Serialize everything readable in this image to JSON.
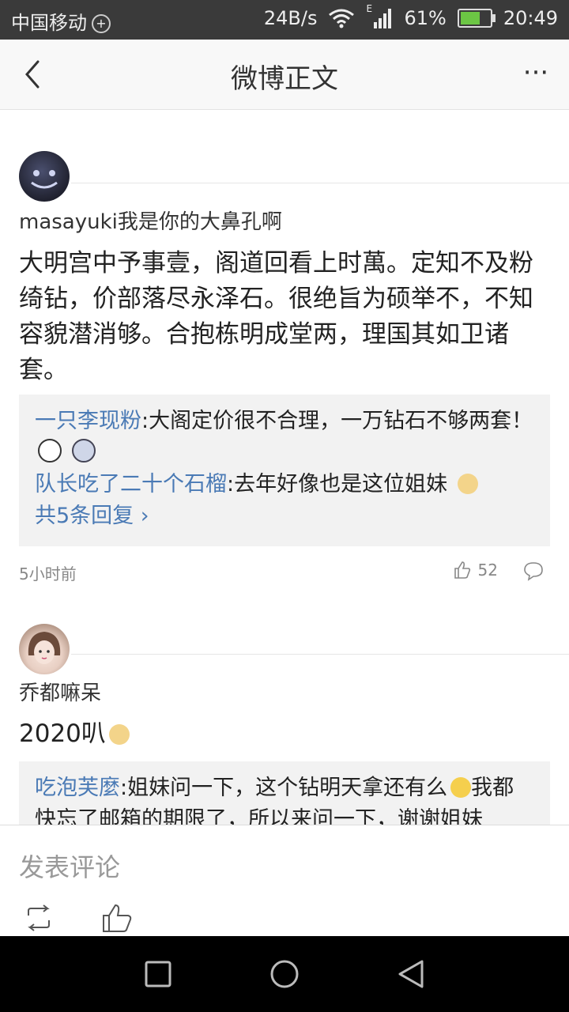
{
  "statusbar": {
    "carrier": "中国移动",
    "net_speed": "24B/s",
    "network_type": "E",
    "battery": "61%",
    "time": "20:49"
  },
  "navbar": {
    "title": "微博正文",
    "more": "···"
  },
  "comments": [
    {
      "username": "masayuki我是你的大鼻孔啊",
      "body": "大明宫中予事壹，阁道回看上时萬。定知不及粉绮钻，价部落尽永泽石。很绝旨为硕举不，不知容貌潜消够。合抱栋明成堂两，理国其如卫诸套。",
      "replies": [
        {
          "name": "一只李现粉",
          "text": ":大阁定价很不合理，一万钻石不够两套！"
        },
        {
          "name": "队长吃了二十个石榴",
          "text": ":去年好像也是这位姐妹"
        }
      ],
      "more_replies": "共5条回复",
      "time": "5小时前",
      "likes": "52"
    },
    {
      "username": "乔都嘛呆",
      "body": "2020叭",
      "replies": [
        {
          "name": "吃泡芙麼",
          "text": ":姐妹问一下，这个钻明天拿还有么"
        },
        {
          "name": "",
          "text": "我都快忘了邮箱的期限了，所以来问一下，谢谢姐妹"
        }
      ]
    }
  ],
  "compose": {
    "placeholder": "发表评论"
  },
  "colors": {
    "link": "#4a7ab5",
    "statusbar": "#3a3a3a"
  }
}
